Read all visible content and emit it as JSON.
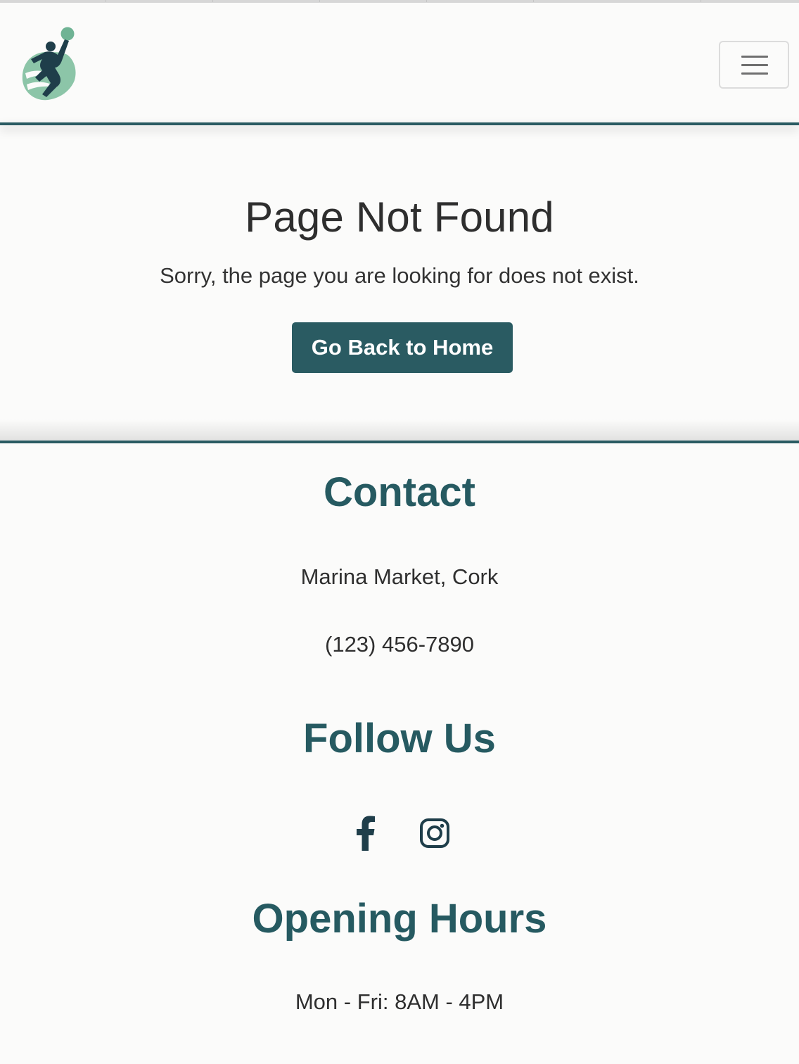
{
  "header": {
    "logo_icon": "athlete-logo-icon",
    "menu_icon": "hamburger-menu-icon"
  },
  "main": {
    "title": "Page Not Found",
    "message": "Sorry, the page you are looking for does not exist.",
    "home_button": "Go Back to Home"
  },
  "footer": {
    "contact": {
      "heading": "Contact",
      "address": "Marina Market, Cork",
      "phone": "(123) 456-7890"
    },
    "follow": {
      "heading": "Follow Us",
      "links": [
        {
          "icon": "facebook-icon"
        },
        {
          "icon": "instagram-icon"
        }
      ]
    },
    "hours": {
      "heading": "Opening Hours",
      "weekdays": "Mon - Fri: 8AM - 4PM"
    }
  },
  "colors": {
    "accent": "#2a5b62",
    "logo_light": "#8cc5a8",
    "logo_dark": "#1f3e4a",
    "background": "#fbfbfa"
  }
}
